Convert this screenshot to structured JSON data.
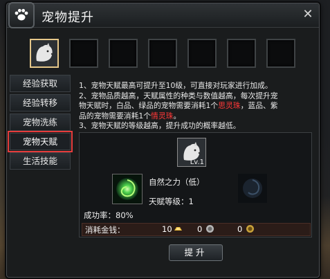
{
  "window": {
    "title": "宠物提升"
  },
  "tabs": [
    {
      "label": "经验获取"
    },
    {
      "label": "经验转移"
    },
    {
      "label": "宠物洗练"
    },
    {
      "label": "宠物天赋"
    },
    {
      "label": "生活技能"
    }
  ],
  "desc": {
    "line1": "1、宠物天赋最高可提升至10级，可直接对玩家进行加成。",
    "line2": "2、宠物品质越高，天赋属性的种类与数值越高，每次提升宠",
    "line3a": "物天赋时，白品、绿品的宠物需要消耗1个",
    "line3red": "思灵珠",
    "line3b": "，蓝品、紫",
    "line4a": "品的宠物需要消耗1个",
    "line4red": "情灵珠",
    "line4b": "。",
    "line5": "3、宠物天赋的等级越高，提升成功的概率越低。"
  },
  "pet": {
    "level": "Lv.1"
  },
  "skill": {
    "name": "自然之力（低）",
    "level_text": "天赋等级：1",
    "rate_text": "成功率：80%"
  },
  "cost": {
    "label": "消耗金钱：",
    "gold": "10",
    "silver": "0",
    "copper": "0"
  },
  "button": {
    "upgrade": "提升"
  },
  "colors": {
    "accent_red": "#e63c3c",
    "highlight_text": "#ff3838"
  }
}
